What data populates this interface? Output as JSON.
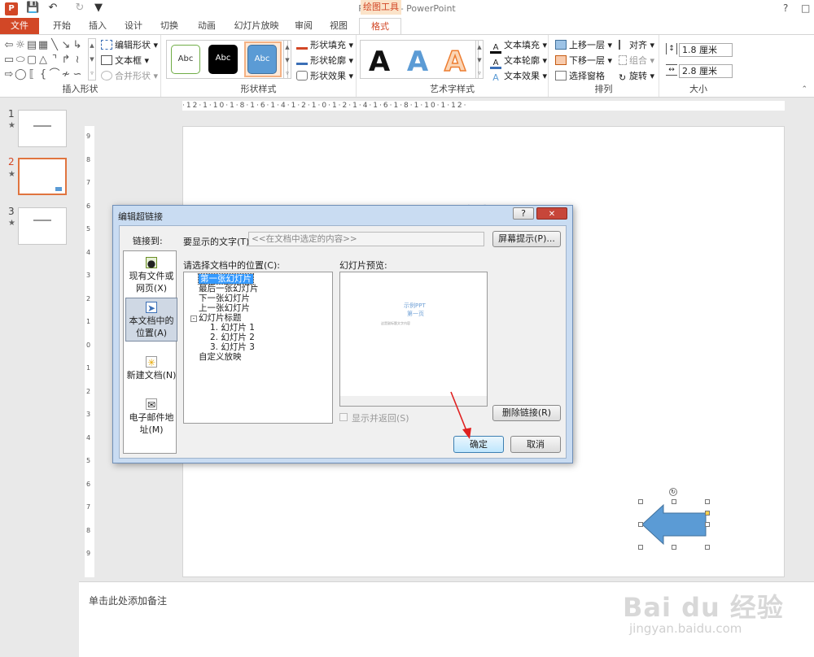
{
  "titlebar": {
    "title": "PPT2013 - PowerPoint",
    "context_tool": "绘图工具",
    "help": "?"
  },
  "tabs": [
    "文件",
    "开始",
    "插入",
    "设计",
    "切换",
    "动画",
    "幻灯片放映",
    "审阅",
    "视图",
    "格式"
  ],
  "ribbon": {
    "insert_shapes": {
      "label": "插入形状",
      "edit_shape": "编辑形状",
      "text_box": "文本框",
      "merge_shapes": "合并形状"
    },
    "shape_styles": {
      "label": "形状样式",
      "sample": "Abc",
      "fill": "形状填充",
      "outline": "形状轮廓",
      "effects": "形状效果"
    },
    "wordart": {
      "label": "艺术字样式",
      "glyph": "A",
      "text_fill": "文本填充",
      "text_outline": "文本轮廓",
      "text_effects": "文本效果"
    },
    "arrange": {
      "label": "排列",
      "bring_forward": "上移一层",
      "send_backward": "下移一层",
      "selection_pane": "选择窗格",
      "align": "对齐",
      "group": "组合",
      "rotate": "旋转"
    },
    "size": {
      "label": "大小",
      "height": "1.8 厘米",
      "width": "2.8 厘米"
    }
  },
  "slides": [
    {
      "num": "1",
      "star": "★"
    },
    {
      "num": "2",
      "star": "★"
    },
    {
      "num": "3",
      "star": "★"
    }
  ],
  "ruler_top": "·12·1·10·1·8·1·6·1·4·1·2·1·0·1·2·1·4·1·6·1·8·1·10·1·12·",
  "ruler_left": [
    "9",
    "8",
    "7",
    "6",
    "5",
    "4",
    "3",
    "2",
    "1",
    "0",
    "1",
    "2",
    "3",
    "4",
    "5",
    "6",
    "7",
    "8",
    "9"
  ],
  "slide_title_fragment": "示例",
  "notes_placeholder": "单击此处添加备注",
  "dialog": {
    "title": "编辑超链接",
    "help": "?",
    "close": "✕",
    "link_to": "链接到:",
    "nav": [
      {
        "label": "现有文件或网页(X)"
      },
      {
        "label": "本文档中的位置(A)"
      },
      {
        "label": "新建文档(N)"
      },
      {
        "label": "电子邮件地址(M)"
      }
    ],
    "display_text_label": "要显示的文字(T):",
    "display_text_value": "<<在文档中选定的内容>>",
    "screentip_button": "屏幕提示(P)...",
    "place_label": "请选择文档中的位置(C):",
    "tree": [
      "第一张幻灯片",
      "最后一张幻灯片",
      "下一张幻灯片",
      "上一张幻灯片",
      "幻灯片标题",
      "1. 幻灯片 1",
      "2. 幻灯片 2",
      "3. 幻灯片 3",
      "自定义放映"
    ],
    "preview_label": "幻灯片预览:",
    "preview_title": "示例PPT",
    "preview_subtitle": "第一页",
    "preview_note": "这是副标题文字内容",
    "show_return": "显示并返回(S)",
    "remove_link": "删除链接(R)",
    "ok": "确定",
    "cancel": "取消"
  },
  "watermark": {
    "brand": "Bai du 经验",
    "url": "jingyan.baidu.com"
  },
  "colors": {
    "accent": "#d24726",
    "shape_blue": "#5b9bd5"
  }
}
